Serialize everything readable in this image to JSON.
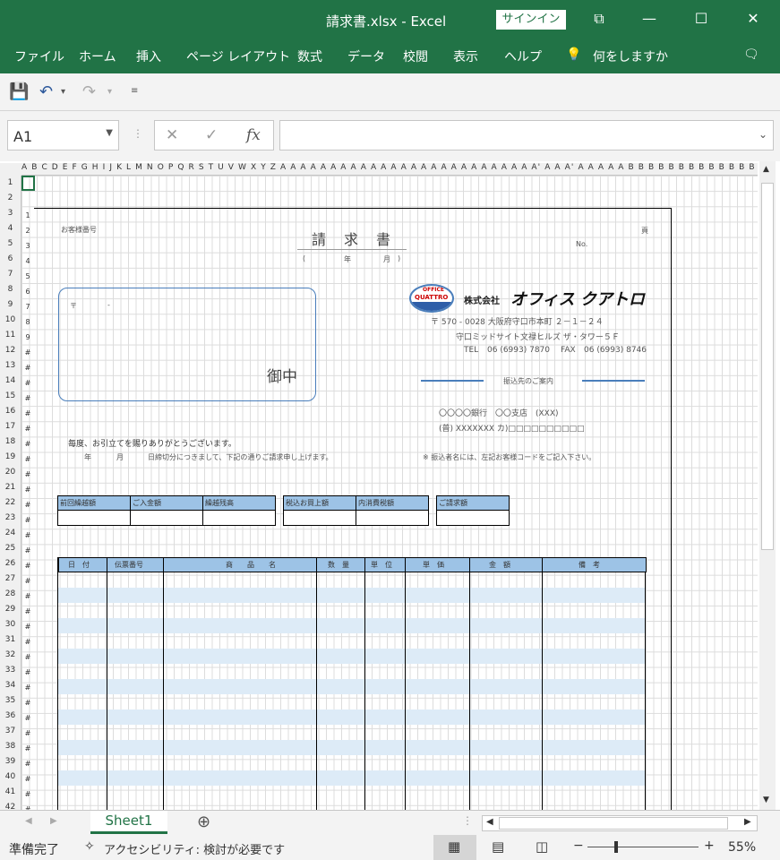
{
  "window": {
    "title": "請求書.xlsx  -  Excel",
    "signin": "サインイン"
  },
  "ribbon_tabs": [
    "ファイル",
    "ホーム",
    "挿入",
    "ページ レイアウト",
    "数式",
    "データ",
    "校閲",
    "表示",
    "ヘルプ",
    "何をしますか"
  ],
  "formula_bar": {
    "name_box": "A1",
    "value": ""
  },
  "column_headers": "A B C D E F G H I J K L M N O P Q R S T U V W X Y Z A A A A A A A A A A A A A A A A A A A A A A A A A A' A A A' A A A A A B B B B B B B B B B B B B B B B B B B B B B B B B B B C C C C C C C C C C C C C",
  "row_numbers": [
    "1",
    "2",
    "3",
    "4",
    "5",
    "6",
    "7",
    "8",
    "9",
    "10",
    "11",
    "12",
    "13",
    "14",
    "15",
    "16",
    "17",
    "18",
    "19",
    "20",
    "21",
    "22",
    "23",
    "24",
    "25",
    "26",
    "27",
    "28",
    "29",
    "30",
    "31",
    "32",
    "33",
    "34",
    "35",
    "36",
    "37",
    "38",
    "39",
    "40",
    "41",
    "42"
  ],
  "page_row_numbers": [
    "1",
    "2",
    "3",
    "4",
    "5",
    "6",
    "7",
    "8",
    "9",
    "#",
    "#",
    "#",
    "#",
    "#",
    "#",
    "#",
    "#",
    "#",
    "#",
    "#",
    "#",
    "#",
    "#",
    "#",
    "#",
    "#",
    "#",
    "#",
    "#",
    "#",
    "#",
    "#",
    "#",
    "#",
    "#",
    "#",
    "#",
    "#",
    "#",
    "#"
  ],
  "invoice": {
    "customer_code_label": "お客様番号",
    "title": "請　求　書",
    "date_paren_open": "(",
    "date_year": "年",
    "date_month": "月",
    "date_paren_close": ")",
    "page_label": "頁",
    "no_label": "No.",
    "postal_mark": "〒",
    "postal_dash": "-",
    "onchu": "御中",
    "logo_line1": "OFFICE",
    "logo_line2": "QUATTRO",
    "company_prefix": "株式会社",
    "company_name": "オフィス クアトロ",
    "address_line1": "〒 570  - 0028   大阪府守口市本町   ２－１－２４",
    "address_line2": "守口ミッドサイト文禄ヒルズ  ザ・タワー５Ｆ",
    "tel_label": "TEL",
    "tel": "06 (6993) 7870",
    "fax_label": "FAX",
    "fax": "06 (6993) 8746",
    "bank_guide": "振込先のご案内",
    "bank_line1": "〇〇〇〇銀行　〇〇支店　(XXX)",
    "bank_line2": "(普) XXXXXXX カ)□□□□□□□□□□",
    "greeting": "毎度、お引立てを賜りありがとうございます。",
    "closing_year": "年",
    "closing_month": "月",
    "closing_text": "日締切分につきまして、下記の通りご請求申し上げます。",
    "note": "※ 振込者名には、左記お客様コードをご記入下さい。",
    "summary_headers": [
      "前回繰越額",
      "ご入金額",
      "繰越残高",
      "税込お買上額",
      "内消費税額",
      "ご請求額"
    ],
    "table_headers": [
      "日　付",
      "伝票番号",
      "商　　品　　名",
      "数　量",
      "単　位",
      "単　価",
      "金　額",
      "備　考"
    ]
  },
  "sheet_tab": "Sheet1",
  "status": {
    "ready": "準備完了",
    "accessibility": "アクセシビリティ: 検討が必要です",
    "zoom": "55%"
  }
}
